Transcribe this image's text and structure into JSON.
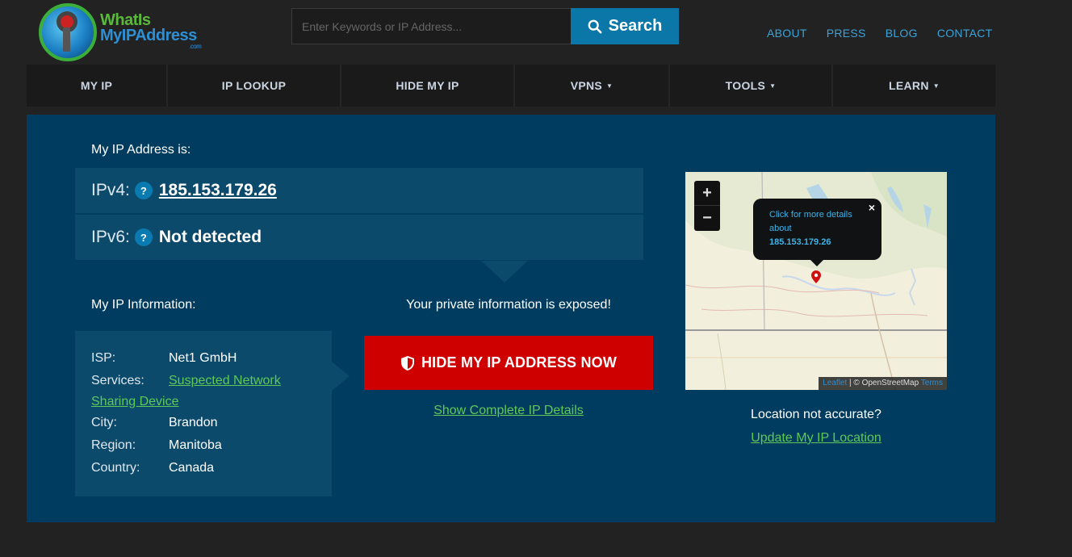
{
  "logo": {
    "line1": "WhatIs",
    "line2": "MyIPAddress",
    "line3": ".com"
  },
  "search": {
    "placeholder": "Enter Keywords or IP Address...",
    "button_label": "Search"
  },
  "top_links": [
    "ABOUT",
    "PRESS",
    "BLOG",
    "CONTACT"
  ],
  "nav": [
    {
      "label": "MY IP",
      "caret": false
    },
    {
      "label": "IP LOOKUP",
      "caret": false
    },
    {
      "label": "HIDE MY IP",
      "caret": false
    },
    {
      "label": "VPNS",
      "caret": true
    },
    {
      "label": "TOOLS",
      "caret": true
    },
    {
      "label": "LEARN",
      "caret": true
    }
  ],
  "main": {
    "ip_heading": "My IP Address is:",
    "ipv4_label": "IPv4:",
    "ipv4_value": "185.153.179.26",
    "ipv6_label": "IPv6:",
    "ipv6_value": "Not detected",
    "help_glyph": "?",
    "info_heading": "My IP Information:",
    "info": {
      "isp_label": "ISP:",
      "isp": "Net1 GmbH",
      "services_label": "Services:",
      "services_line1": "Suspected Network",
      "services_line2": "Sharing Device",
      "city_label": "City:",
      "city": "Brandon",
      "region_label": "Region:",
      "region": "Manitoba",
      "country_label": "Country:",
      "country": "Canada"
    },
    "exposed_text": "Your private information is exposed!",
    "hide_button": "HIDE MY IP ADDRESS NOW",
    "details_link": "Show Complete IP Details",
    "map": {
      "zoom_in": "+",
      "zoom_out": "−",
      "popup_line1": "Click for more details",
      "popup_line2": "about",
      "popup_ip": "185.153.179.26",
      "popup_close": "×",
      "attrib_leaflet": "Leaflet",
      "attrib_sep": " | © OpenStreetMap",
      "attrib_terms": " Terms"
    },
    "location_question": "Location not accurate?",
    "location_link": "Update My IP Location"
  },
  "colors": {
    "page_bg": "#222223",
    "panel_bg": "#003c5f",
    "accent_blue": "#0b77a8",
    "cta_red": "#cf0000",
    "link_green": "#5ec957"
  }
}
